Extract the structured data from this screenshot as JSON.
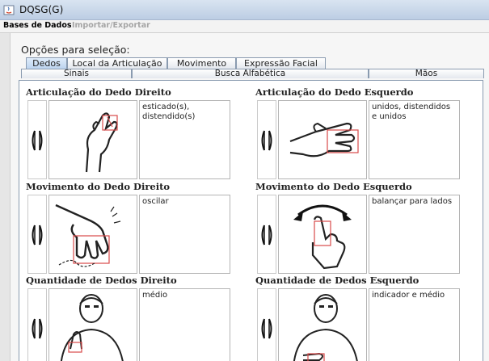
{
  "window": {
    "title": "DQSG(G)"
  },
  "menu": {
    "items": [
      "Bases de Dados",
      "Importar/Exportar"
    ]
  },
  "options_label": "Opções para seleção:",
  "tabs_row1": [
    "Dedos",
    "Local da Articulação",
    "Movimento",
    "Expressão Facial"
  ],
  "tabs_row2": [
    "Sinais",
    "Busca Alfabética",
    "Mãos"
  ],
  "active_tab": "Dedos",
  "sections": [
    {
      "title": "Articulação do Dedo Direito",
      "value": "esticado(s), distendido(s)",
      "image": "right-finger-articulation-image"
    },
    {
      "title": "Articulação do Dedo Esquerdo",
      "value": "unidos, distendidos e unidos",
      "image": "left-finger-articulation-image"
    },
    {
      "title": "Movimento do Dedo Direito",
      "value": "oscilar",
      "image": "right-finger-movement-image"
    },
    {
      "title": "Movimento do Dedo Esquerdo",
      "value": "balançar para lados",
      "image": "left-finger-movement-image"
    },
    {
      "title": "Quantidade de Dedos Direito",
      "value": "médio",
      "image": "right-finger-count-image"
    },
    {
      "title": "Quantidade de Dedos Esquerdo",
      "value": "indicador e médio",
      "image": "left-finger-count-image"
    }
  ],
  "colors": {
    "highlight": "#d94a4a",
    "tab_border": "#8a9bb0",
    "title_bar": "#c8d6e8"
  }
}
